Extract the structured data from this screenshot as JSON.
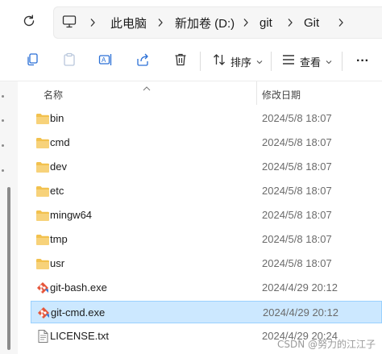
{
  "address": {
    "crumbs": [
      "此电脑",
      "新加卷 (D:)",
      "git",
      "Git"
    ]
  },
  "toolbar": {
    "sort_label": "排序",
    "view_label": "查看",
    "more_label": "···"
  },
  "columns": {
    "name": "名称",
    "modified": "修改日期"
  },
  "files": [
    {
      "name": "bin",
      "modified": "2024/5/8 18:07",
      "kind": "folder"
    },
    {
      "name": "cmd",
      "modified": "2024/5/8 18:07",
      "kind": "folder"
    },
    {
      "name": "dev",
      "modified": "2024/5/8 18:07",
      "kind": "folder"
    },
    {
      "name": "etc",
      "modified": "2024/5/8 18:07",
      "kind": "folder"
    },
    {
      "name": "mingw64",
      "modified": "2024/5/8 18:07",
      "kind": "folder"
    },
    {
      "name": "tmp",
      "modified": "2024/5/8 18:07",
      "kind": "folder"
    },
    {
      "name": "usr",
      "modified": "2024/5/8 18:07",
      "kind": "folder"
    },
    {
      "name": "git-bash.exe",
      "modified": "2024/4/29 20:12",
      "kind": "git-exe"
    },
    {
      "name": "git-cmd.exe",
      "modified": "2024/4/29 20:12",
      "kind": "git-exe",
      "selected": true
    },
    {
      "name": "LICENSE.txt",
      "modified": "2024/4/29 20:24",
      "kind": "text"
    }
  ],
  "watermark": "CSDN @努力的江江子",
  "colors": {
    "folder": "#f2c14e",
    "selection": "#cce8ff",
    "selection_border": "#99d1ff"
  },
  "icons": [
    "refresh-icon",
    "computer-icon",
    "chevron-right-icon",
    "chevron-down-icon",
    "copy-icon",
    "paste-icon",
    "rename-icon",
    "share-icon",
    "delete-icon",
    "sort-icon",
    "view-icon",
    "folder-icon",
    "git-icon",
    "text-file-icon"
  ]
}
